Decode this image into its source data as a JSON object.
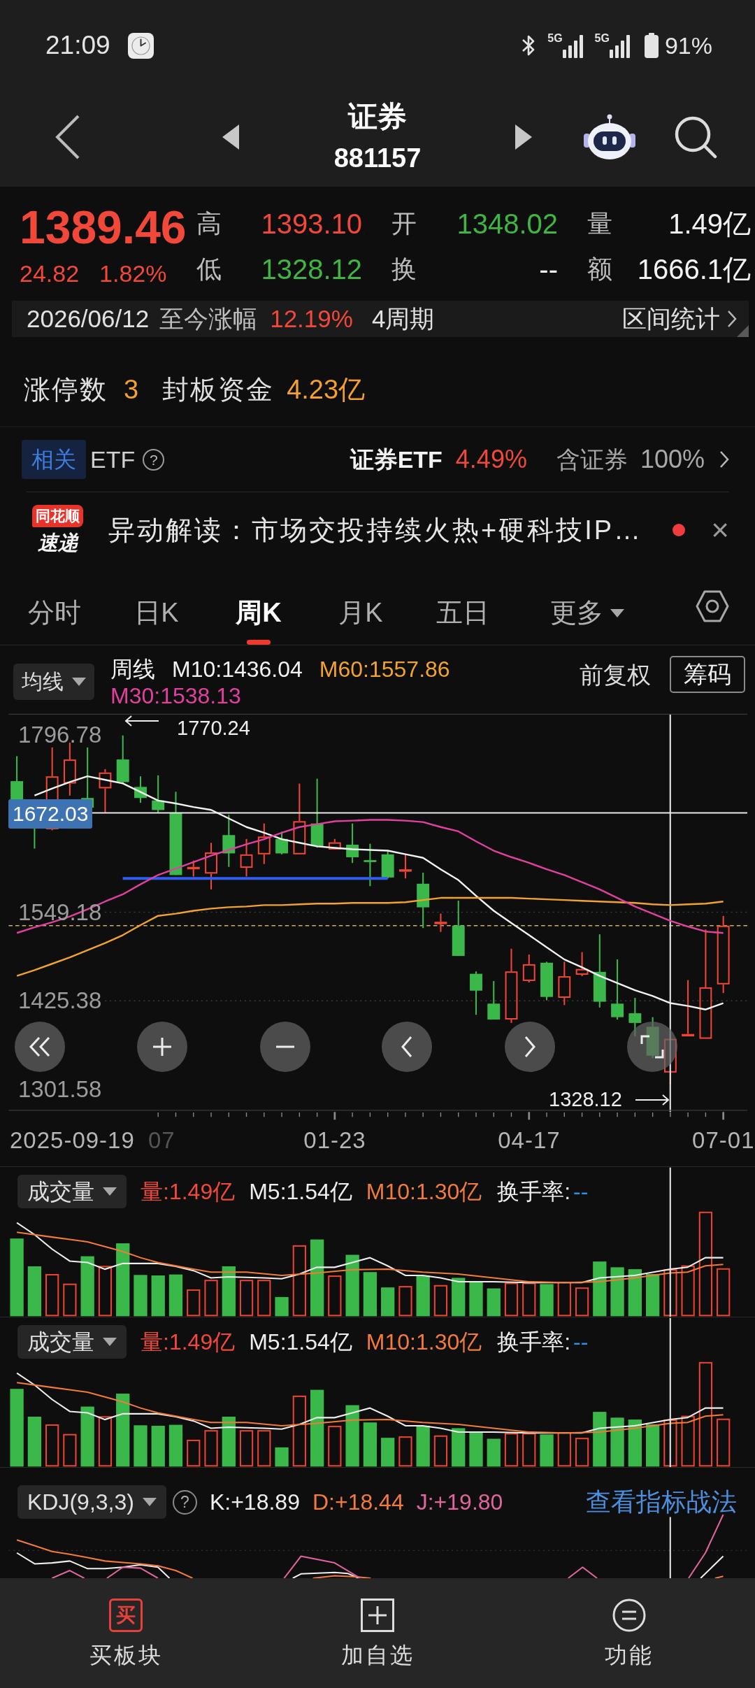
{
  "status_bar": {
    "time": "21:09",
    "networks": [
      "5G",
      "5G"
    ],
    "battery": "91%"
  },
  "header": {
    "title": "证券",
    "code": "881157"
  },
  "quote": {
    "price": "1389.46",
    "change": "24.82",
    "change_percent": "1.82%",
    "stats": [
      {
        "label": "高",
        "value": "1393.10",
        "color": "#f2483a"
      },
      {
        "label": "开",
        "value": "1348.02",
        "color": "#3fb542"
      },
      {
        "label": "量",
        "value": "1.49亿",
        "color": "#f2f2f2"
      },
      {
        "label": "低",
        "value": "1328.12",
        "color": "#3fb542"
      },
      {
        "label": "换",
        "value": "--",
        "color": "#f2f2f2"
      },
      {
        "label": "额",
        "value": "1666.1亿",
        "color": "#f2f2f2"
      }
    ]
  },
  "range": {
    "date": "2026/06/12",
    "label": "至今涨幅",
    "change": "12.19%",
    "period": "4周期",
    "link": "区间统计"
  },
  "limit_up": {
    "count_label": "涨停数",
    "count": "3",
    "fund_label": "封板资金",
    "fund": "4.23亿"
  },
  "etf": {
    "tag": "相关",
    "label": "ETF",
    "help": "?",
    "name": "证券ETF",
    "change": "4.49%",
    "holding_label": "含证券",
    "holding": "100%"
  },
  "news": {
    "logo_tag": "同花顺",
    "logo_caption": "速递",
    "headline": "异动解读：市场交投持续火热+硬科技IP…",
    "unread": true,
    "close": "×"
  },
  "tabs": [
    {
      "label": "分时",
      "kind": "tab",
      "selected": false
    },
    {
      "label": "日K",
      "kind": "tab",
      "selected": false
    },
    {
      "label": "周K",
      "kind": "tab",
      "selected": true
    },
    {
      "label": "月K",
      "kind": "tab",
      "selected": false
    },
    {
      "label": "五日",
      "kind": "tab",
      "selected": false
    },
    {
      "label": "更多",
      "kind": "menu",
      "selected": false
    }
  ],
  "chart": {
    "indicator": "均线",
    "period": "周线",
    "legend_separator": ":",
    "averages": [
      {
        "value": "1436.04"
      },
      {
        "value": "1557.86"
      },
      {
        "value": "1538.13"
      }
    ],
    "adjust": "前复权",
    "chips": "筹码",
    "crosshair_price": "1672.03",
    "high_note": "1770.24",
    "low_note": "1328.12",
    "start_date_label": "2025-09-19",
    "faded_x_label": "07",
    "chart_data": {
      "type": "line",
      "categories": [
        null,
        null,
        null,
        null,
        null,
        null,
        null,
        null,
        null,
        null,
        null,
        null,
        null,
        null,
        null,
        null,
        null,
        null,
        "01-23",
        null,
        null,
        null,
        null,
        null,
        null,
        null,
        null,
        null,
        null,
        "04-17",
        null,
        null,
        null,
        null,
        null,
        null,
        null,
        null,
        null,
        null,
        "07-01"
      ],
      "ylim": [
        1272.1,
        1825.7
      ],
      "yticks": [
        1301.58,
        1425.38,
        1549.18,
        1796.78
      ],
      "series": [
        {
          "name": "M10",
          "color": "#f2f2f2",
          "values": [
            null,
            1712,
            1722,
            1731,
            1739,
            1734,
            1729,
            1717,
            1705,
            1701,
            1696,
            1692,
            1680,
            1668,
            1660,
            1651,
            1646,
            1641,
            1639,
            1637,
            1636,
            1635,
            1630,
            1625,
            1609,
            1594,
            1572,
            1551,
            1534,
            1517,
            1500,
            1483,
            1472,
            1460,
            1450,
            1440,
            1432,
            1422,
            1418,
            1413,
            1422
          ]
        },
        {
          "name": "M60",
          "color": "#f2a32e",
          "values": [
            1460,
            1468,
            1477,
            1486,
            1496,
            1506,
            1517,
            1531,
            1544,
            1547,
            1551,
            1554,
            1556,
            1557,
            1559,
            1559,
            1560,
            1561,
            1561,
            1562,
            1562,
            1562,
            1563,
            1566,
            1569,
            1569,
            1569,
            1569,
            1569,
            1568,
            1567,
            1566,
            1565,
            1564,
            1563,
            1562,
            1560,
            1559,
            1560,
            1561,
            1564
          ]
        },
        {
          "name": "M30",
          "color": "#e2409e",
          "values": [
            1520,
            1528,
            1535,
            1543,
            1553,
            1564,
            1574,
            1588,
            1601,
            1610,
            1619,
            1628,
            1636,
            1644,
            1651,
            1660,
            1668,
            1672,
            1676,
            1677,
            1678,
            1678,
            1677,
            1675,
            1668,
            1662,
            1648,
            1635,
            1626,
            1618,
            1609,
            1601,
            1591,
            1581,
            1569,
            1557,
            1547,
            1537,
            1529,
            1522,
            1520
          ]
        }
      ]
    }
  },
  "volume_panels": [
    {
      "indicator": "成交量",
      "items": [
        {
          "label": "量:1.49亿",
          "color": "#f2483a"
        },
        {
          "label": "M5:1.54亿",
          "color": "#eeeeee"
        },
        {
          "label": "M10:1.30亿",
          "color": "#f27a3a"
        }
      ],
      "turnover": {
        "label": "换手率:",
        "value": "--"
      }
    },
    {
      "indicator": "成交量",
      "items": [
        {
          "label": "量:1.49亿",
          "color": "#f2483a"
        },
        {
          "label": "M5:1.54亿",
          "color": "#eeeeee"
        },
        {
          "label": "M10:1.30亿",
          "color": "#f27a3a"
        }
      ],
      "turnover": {
        "label": "换手率:",
        "value": "--"
      }
    }
  ],
  "kdj": {
    "indicator": "KDJ(9,3,3)",
    "help": "?",
    "items": [
      {
        "label": "K:+18.89",
        "color": "#eeeeee"
      },
      {
        "label": "D:+18.44",
        "color": "#f27a3a"
      },
      {
        "label": "J:+19.80",
        "color": "#e0649e"
      }
    ],
    "link": "查看指标战法"
  },
  "bottom_nav": [
    {
      "kind": "buy",
      "icon_text": "买",
      "label": "买板块"
    },
    {
      "kind": "add",
      "label": "加自选"
    },
    {
      "kind": "menu",
      "label": "功能"
    }
  ]
}
